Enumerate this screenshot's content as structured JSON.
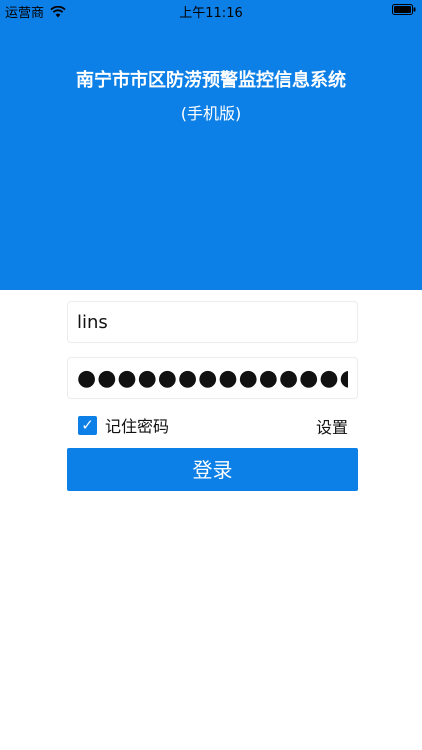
{
  "status_bar": {
    "carrier": "运营商",
    "time": "上午11:16",
    "wifi_icon": "wifi-icon",
    "battery_icon": "battery-icon"
  },
  "header": {
    "title": "南宁市市区防涝预警监控信息系统",
    "subtitle": "(手机版)",
    "background_color": "#0d80e8"
  },
  "login_form": {
    "username_value": "lins",
    "password_value": "●●●●●●●●●●●●●●",
    "remember_label": "记住密码",
    "remember_checked": true,
    "settings_label": "设置",
    "login_label": "登录",
    "accent_color": "#0d80e8"
  }
}
